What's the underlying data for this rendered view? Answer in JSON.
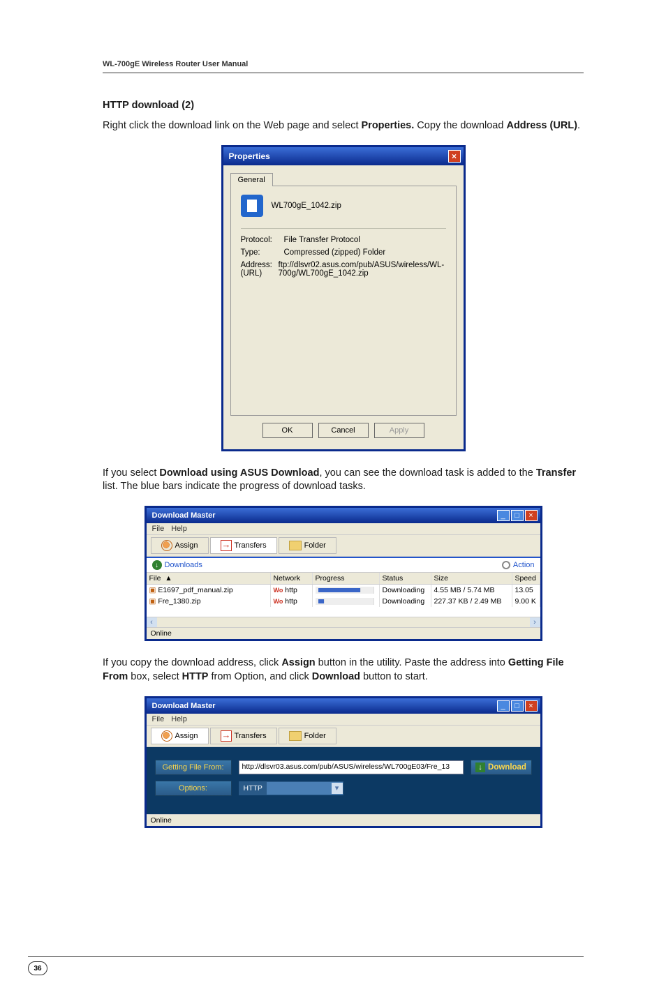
{
  "header": {
    "manual_title": "WL-700gE Wireless Router User Manual"
  },
  "section": {
    "heading": "HTTP download (2)",
    "para1_a": "Right click the download link on the Web page and select ",
    "para1_b": "Properties.",
    "para1_c": " Copy the download ",
    "para1_d": "Address (URL)",
    "para1_e": "."
  },
  "props": {
    "titlebar": "Properties",
    "tab_general": "General",
    "filename": "WL700gE_1042.zip",
    "labels": {
      "protocol": "Protocol:",
      "type": "Type:",
      "address": "Address:",
      "url": "(URL)"
    },
    "values": {
      "protocol": "File Transfer Protocol",
      "type": "Compressed (zipped) Folder",
      "address": "ftp://dlsvr02.asus.com/pub/ASUS/wireless/WL-700g/WL700gE_1042.zip"
    },
    "buttons": {
      "ok": "OK",
      "cancel": "Cancel",
      "apply": "Apply"
    }
  },
  "para2": {
    "a": "If you select ",
    "b": "Download using ASUS Download",
    "c": ", you can see the download task is added to the ",
    "d": "Transfer",
    "e": " list. The blue bars indicate the progress of download tasks."
  },
  "dm1": {
    "title": "Download Master",
    "menu": {
      "file": "File",
      "help": "Help"
    },
    "tabs": {
      "assign": "Assign",
      "transfers": "Transfers",
      "folder": "Folder"
    },
    "subbar": {
      "downloads": "Downloads",
      "action": "Action"
    },
    "cols": {
      "file": "File",
      "arrow": "▲",
      "network": "Network",
      "progress": "Progress",
      "status": "Status",
      "size": "Size",
      "speed": "Speed"
    },
    "rows": [
      {
        "file": "E1697_pdf_manual.zip",
        "net_prefix": "Wo",
        "net": "http",
        "progress_pct": 82,
        "status": "Downloading",
        "size": "4.55 MB / 5.74 MB",
        "speed": "13.05"
      },
      {
        "file": "Fre_1380.zip",
        "net_prefix": "Wo",
        "net": "http",
        "progress_pct": 8,
        "status": "Downloading",
        "size": "227.37 KB / 2.49 MB",
        "speed": "9.00 K"
      }
    ],
    "status": "Online"
  },
  "para3": {
    "a": "If you copy the download address, click ",
    "b": "Assign",
    "c": " button in the utility. Paste the address into ",
    "d": "Getting File From",
    "e": " box, select ",
    "f": "HTTP",
    "g": " from Option, and click ",
    "h": "Download",
    "i": " button to start."
  },
  "dm2": {
    "title": "Download Master",
    "menu": {
      "file": "File",
      "help": "Help"
    },
    "tabs": {
      "assign": "Assign",
      "transfers": "Transfers",
      "folder": "Folder"
    },
    "labels": {
      "getting": "Getting File From:",
      "options": "Options:"
    },
    "url": "http://dlsvr03.asus.com/pub/ASUS/wireless/WL700gE03/Fre_13",
    "opt_value": "HTTP",
    "download_btn": "Download",
    "status": "Online"
  },
  "footer": {
    "page": "36"
  }
}
